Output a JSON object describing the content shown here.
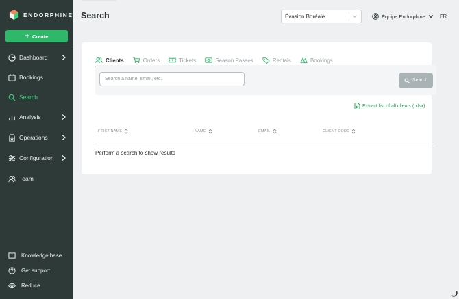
{
  "brand": {
    "name": "ENDORPHINE"
  },
  "sidebar": {
    "create_label": "Create",
    "items": [
      {
        "label": "Dashboard",
        "icon": "dashboard-icon",
        "has_submenu": true
      },
      {
        "label": "Bookings",
        "icon": "calendar-icon",
        "has_submenu": false
      },
      {
        "label": "Search",
        "icon": "search-icon",
        "has_submenu": false,
        "active": true
      },
      {
        "label": "Analysis",
        "icon": "bar-chart-icon",
        "has_submenu": true
      },
      {
        "label": "Operations",
        "icon": "operations-icon",
        "has_submenu": true
      },
      {
        "label": "Configuration",
        "icon": "sliders-icon",
        "has_submenu": true
      },
      {
        "label": "Team",
        "icon": "team-icon",
        "has_submenu": false
      }
    ],
    "bottom": [
      {
        "label": "Knowledge base",
        "icon": "book-icon"
      },
      {
        "label": "Get support",
        "icon": "help-icon"
      },
      {
        "label": "Reduce",
        "icon": "eye-icon"
      }
    ]
  },
  "header": {
    "title": "Search",
    "org_select": "Évasion Boréale",
    "team_label": "Équipe Endorphine",
    "language": "FR"
  },
  "tabs": [
    {
      "label": "Clients",
      "icon": "clients-icon",
      "active": true
    },
    {
      "label": "Orders",
      "icon": "cart-icon"
    },
    {
      "label": "Tickets",
      "icon": "ticket-icon"
    },
    {
      "label": "Season Passes",
      "icon": "pass-icon"
    },
    {
      "label": "Rentals",
      "icon": "tag-icon"
    },
    {
      "label": "Bookings",
      "icon": "booking-icon"
    }
  ],
  "search": {
    "placeholder": "Search a name, email, etc.",
    "value": "",
    "button_label": "Search"
  },
  "extract_label": "Extract list of all clients (.xlsx)",
  "table": {
    "columns": [
      "FIRST NAME",
      "NAME",
      "EMAIL",
      "CLIENT CODE"
    ]
  },
  "empty_message": "Perform a search to show results",
  "colors": {
    "sidebar_bg": "#2d3a38",
    "accent": "#2fb86a",
    "active_nav": "#3ccf7f",
    "page_bg": "#eef0f2"
  }
}
